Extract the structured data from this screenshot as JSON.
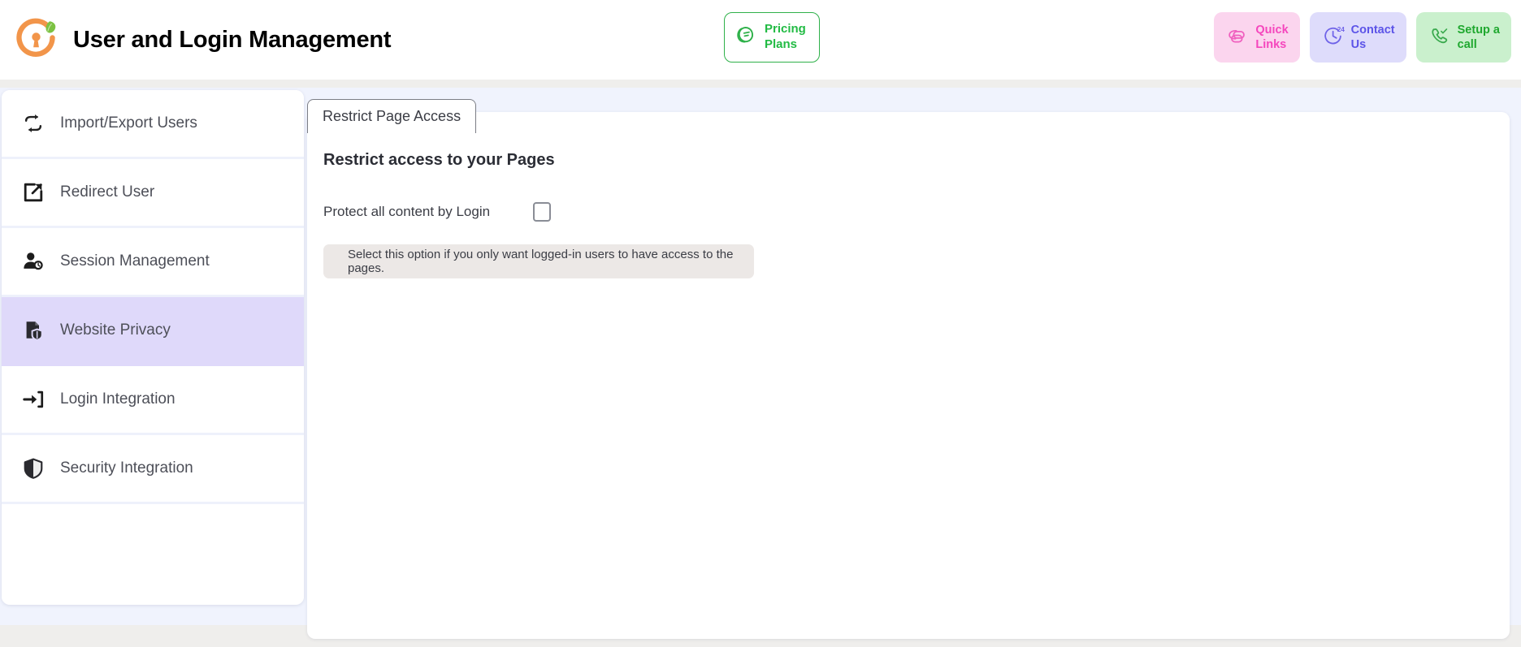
{
  "header": {
    "title": "User and Login Management",
    "logo_icon": "orange-keyhole-leaf-logo",
    "pricing_button": {
      "label": "Pricing\nPlans",
      "icon": "pricing-cards-icon",
      "accent": "#22bb44"
    },
    "actions": [
      {
        "id": "quick-links",
        "label": "Quick\nLinks",
        "icon": "linked-chain-icon",
        "bg": "#fbd5ee",
        "fg": "#f546bd"
      },
      {
        "id": "contact-us",
        "label": "Contact\nUs",
        "icon": "clock-24-icon",
        "badge": "24",
        "bg": "#dedcfb",
        "fg": "#5c54e8"
      },
      {
        "id": "setup-call",
        "label": "Setup a\ncall",
        "icon": "phone-check-icon",
        "bg": "#caf0cd",
        "fg": "#1fa82f"
      }
    ]
  },
  "sidebar": {
    "items": [
      {
        "label": "Import/Export Users",
        "icon": "import-export-arrows-icon",
        "active": false
      },
      {
        "label": "Redirect User",
        "icon": "external-link-icon",
        "active": false
      },
      {
        "label": "Session Management",
        "icon": "user-clock-icon",
        "active": false
      },
      {
        "label": "Website Privacy",
        "icon": "file-shield-icon",
        "active": true
      },
      {
        "label": "Login Integration",
        "icon": "login-arrow-icon",
        "active": false
      },
      {
        "label": "Security Integration",
        "icon": "shield-icon",
        "active": false
      }
    ]
  },
  "main": {
    "tabs": [
      {
        "label": "Restrict Page Access",
        "active": true
      }
    ],
    "section_heading": "Restrict access to your Pages",
    "protect_label": "Protect all content by Login",
    "protect_checked": false,
    "info_text": "Select this option if you only want logged-in users to have access to the pages."
  },
  "colors": {
    "page_background": "#f0f3fd",
    "chrome_band": "#efeeec",
    "panel": "#ffffff",
    "sidebar_active": "#dfd9fa",
    "info_box": "#ece8e6",
    "logo_orange": "#f2954a",
    "logo_leaf_green": "#7cc242"
  }
}
